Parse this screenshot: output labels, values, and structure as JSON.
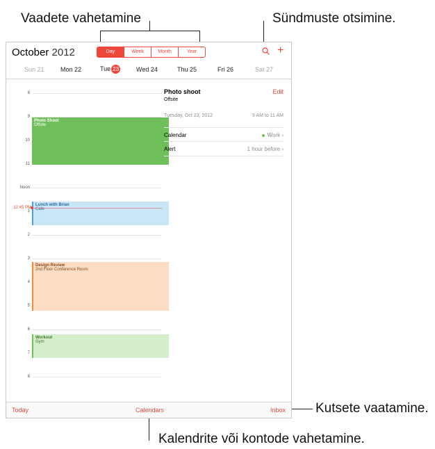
{
  "callouts": {
    "views": "Vaadete vahetamine",
    "search": "Sündmuste otsimine.",
    "invites": "Kutsete vaatamine.",
    "calendars": "Kalendrite või kontode vahetamine."
  },
  "header": {
    "month": "October",
    "year": "2012",
    "segments": [
      "Day",
      "Week",
      "Month",
      "Year"
    ],
    "selected_segment": "Day",
    "accent_color": "#f0463c"
  },
  "week": {
    "days": [
      {
        "label": "Sun 21",
        "weekend": true
      },
      {
        "label": "Mon 22",
        "weekend": false
      },
      {
        "label": "Tue",
        "badge": "23",
        "today": true
      },
      {
        "label": "Wed 24",
        "weekend": false
      },
      {
        "label": "Thu 25",
        "weekend": false
      },
      {
        "label": "Fri 26",
        "weekend": false
      },
      {
        "label": "Sat 27",
        "weekend": true
      }
    ]
  },
  "timeline": {
    "hours": [
      "8",
      "9",
      "10",
      "11",
      "Noon",
      "1",
      "2",
      "3",
      "4",
      "5",
      "6",
      "7",
      "8"
    ],
    "now_label": "12:45 PM"
  },
  "events": [
    {
      "title": "Photo Shoot",
      "location": "Offsite",
      "color": "#6fbf5a"
    },
    {
      "title": "Lunch with Brian",
      "location": "Cafe",
      "color": "#4aa3df"
    },
    {
      "title": "Design Review",
      "location": "2nd Floor Conference Room",
      "color": "#f28c38"
    },
    {
      "title": "Workout",
      "location": "Gym",
      "color": "#6fbf5a"
    }
  ],
  "detail": {
    "title": "Photo shoot",
    "subtitle": "Offsite",
    "edit_label": "Edit",
    "date": "Tuesday, Oct 23, 2012",
    "time": "9 AM to 11 AM",
    "rows": [
      {
        "label": "Calendar",
        "value": "Work"
      },
      {
        "label": "Alert",
        "value": "1 hour before"
      }
    ]
  },
  "tabbar": {
    "today": "Today",
    "calendars": "Calendars",
    "inbox": "Inbox"
  }
}
